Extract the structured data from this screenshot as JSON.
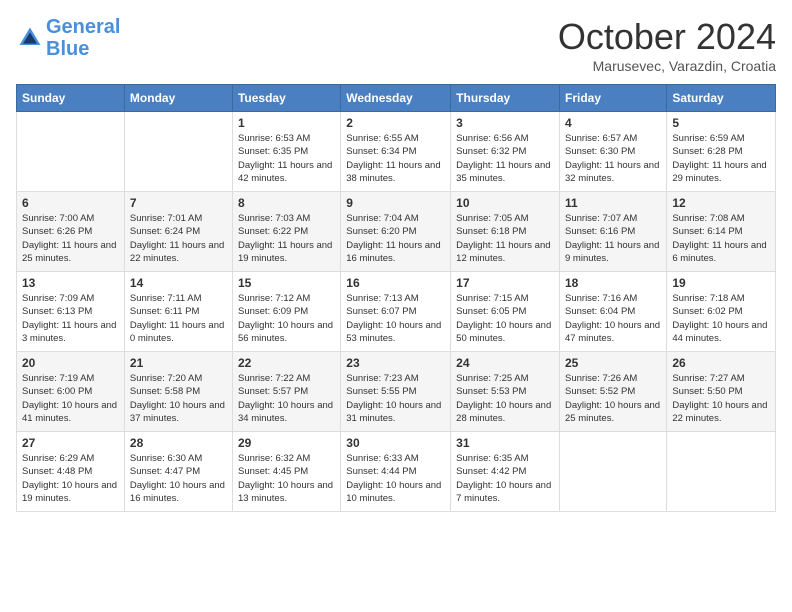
{
  "header": {
    "logo_line1": "General",
    "logo_line2": "Blue",
    "month_year": "October 2024",
    "location": "Marusevec, Varazdin, Croatia"
  },
  "days_of_week": [
    "Sunday",
    "Monday",
    "Tuesday",
    "Wednesday",
    "Thursday",
    "Friday",
    "Saturday"
  ],
  "weeks": [
    [
      {
        "day": "",
        "info": ""
      },
      {
        "day": "",
        "info": ""
      },
      {
        "day": "1",
        "info": "Sunrise: 6:53 AM\nSunset: 6:35 PM\nDaylight: 11 hours and 42 minutes."
      },
      {
        "day": "2",
        "info": "Sunrise: 6:55 AM\nSunset: 6:34 PM\nDaylight: 11 hours and 38 minutes."
      },
      {
        "day": "3",
        "info": "Sunrise: 6:56 AM\nSunset: 6:32 PM\nDaylight: 11 hours and 35 minutes."
      },
      {
        "day": "4",
        "info": "Sunrise: 6:57 AM\nSunset: 6:30 PM\nDaylight: 11 hours and 32 minutes."
      },
      {
        "day": "5",
        "info": "Sunrise: 6:59 AM\nSunset: 6:28 PM\nDaylight: 11 hours and 29 minutes."
      }
    ],
    [
      {
        "day": "6",
        "info": "Sunrise: 7:00 AM\nSunset: 6:26 PM\nDaylight: 11 hours and 25 minutes."
      },
      {
        "day": "7",
        "info": "Sunrise: 7:01 AM\nSunset: 6:24 PM\nDaylight: 11 hours and 22 minutes."
      },
      {
        "day": "8",
        "info": "Sunrise: 7:03 AM\nSunset: 6:22 PM\nDaylight: 11 hours and 19 minutes."
      },
      {
        "day": "9",
        "info": "Sunrise: 7:04 AM\nSunset: 6:20 PM\nDaylight: 11 hours and 16 minutes."
      },
      {
        "day": "10",
        "info": "Sunrise: 7:05 AM\nSunset: 6:18 PM\nDaylight: 11 hours and 12 minutes."
      },
      {
        "day": "11",
        "info": "Sunrise: 7:07 AM\nSunset: 6:16 PM\nDaylight: 11 hours and 9 minutes."
      },
      {
        "day": "12",
        "info": "Sunrise: 7:08 AM\nSunset: 6:14 PM\nDaylight: 11 hours and 6 minutes."
      }
    ],
    [
      {
        "day": "13",
        "info": "Sunrise: 7:09 AM\nSunset: 6:13 PM\nDaylight: 11 hours and 3 minutes."
      },
      {
        "day": "14",
        "info": "Sunrise: 7:11 AM\nSunset: 6:11 PM\nDaylight: 11 hours and 0 minutes."
      },
      {
        "day": "15",
        "info": "Sunrise: 7:12 AM\nSunset: 6:09 PM\nDaylight: 10 hours and 56 minutes."
      },
      {
        "day": "16",
        "info": "Sunrise: 7:13 AM\nSunset: 6:07 PM\nDaylight: 10 hours and 53 minutes."
      },
      {
        "day": "17",
        "info": "Sunrise: 7:15 AM\nSunset: 6:05 PM\nDaylight: 10 hours and 50 minutes."
      },
      {
        "day": "18",
        "info": "Sunrise: 7:16 AM\nSunset: 6:04 PM\nDaylight: 10 hours and 47 minutes."
      },
      {
        "day": "19",
        "info": "Sunrise: 7:18 AM\nSunset: 6:02 PM\nDaylight: 10 hours and 44 minutes."
      }
    ],
    [
      {
        "day": "20",
        "info": "Sunrise: 7:19 AM\nSunset: 6:00 PM\nDaylight: 10 hours and 41 minutes."
      },
      {
        "day": "21",
        "info": "Sunrise: 7:20 AM\nSunset: 5:58 PM\nDaylight: 10 hours and 37 minutes."
      },
      {
        "day": "22",
        "info": "Sunrise: 7:22 AM\nSunset: 5:57 PM\nDaylight: 10 hours and 34 minutes."
      },
      {
        "day": "23",
        "info": "Sunrise: 7:23 AM\nSunset: 5:55 PM\nDaylight: 10 hours and 31 minutes."
      },
      {
        "day": "24",
        "info": "Sunrise: 7:25 AM\nSunset: 5:53 PM\nDaylight: 10 hours and 28 minutes."
      },
      {
        "day": "25",
        "info": "Sunrise: 7:26 AM\nSunset: 5:52 PM\nDaylight: 10 hours and 25 minutes."
      },
      {
        "day": "26",
        "info": "Sunrise: 7:27 AM\nSunset: 5:50 PM\nDaylight: 10 hours and 22 minutes."
      }
    ],
    [
      {
        "day": "27",
        "info": "Sunrise: 6:29 AM\nSunset: 4:48 PM\nDaylight: 10 hours and 19 minutes."
      },
      {
        "day": "28",
        "info": "Sunrise: 6:30 AM\nSunset: 4:47 PM\nDaylight: 10 hours and 16 minutes."
      },
      {
        "day": "29",
        "info": "Sunrise: 6:32 AM\nSunset: 4:45 PM\nDaylight: 10 hours and 13 minutes."
      },
      {
        "day": "30",
        "info": "Sunrise: 6:33 AM\nSunset: 4:44 PM\nDaylight: 10 hours and 10 minutes."
      },
      {
        "day": "31",
        "info": "Sunrise: 6:35 AM\nSunset: 4:42 PM\nDaylight: 10 hours and 7 minutes."
      },
      {
        "day": "",
        "info": ""
      },
      {
        "day": "",
        "info": ""
      }
    ]
  ]
}
